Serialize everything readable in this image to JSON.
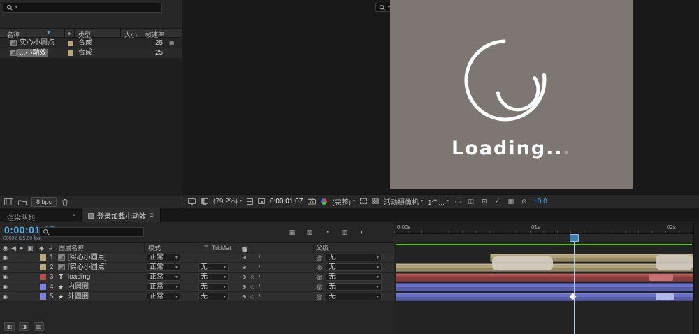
{
  "colors": {
    "accent_blue": "#3fa0ff",
    "time_display_blue": "#53a9e8",
    "comp_background": "#7d7672",
    "label_tan": "#b9a87e",
    "label_red": "#b94b4b",
    "label_blue": "#7d82dd",
    "bar_tan": "#b3a47c",
    "bar_red": "#a34a4a",
    "bar_blue": "#6b70c6",
    "work_area_green": "#5abf22"
  },
  "icons": {
    "caret_down": "▾",
    "sort_down": "▼",
    "close": "×",
    "menu": "≡",
    "tag": "◆",
    "hash": "#",
    "eye": "◉",
    "audio": "◀",
    "solo": "●",
    "lock": "▣",
    "collapse": "⊕",
    "fx_diamond": "◇",
    "quality": "/",
    "pickwhip": "@",
    "star": "★",
    "text_layer": "T",
    "flowchart": "▦",
    "sw_header": [
      "⊕",
      "◇",
      "\\",
      "fx",
      "▣",
      "⊘",
      "◎",
      "⊙"
    ],
    "tl_buttons": [
      "▦",
      "▧",
      "◔",
      "▥",
      "◐"
    ],
    "vt_buttons": [
      "▭",
      "◫",
      "⊞",
      "∠",
      "▦",
      "⊛"
    ],
    "bottom_buttons": [
      "◧",
      "◨",
      "▥"
    ]
  },
  "project": {
    "search_text": "",
    "columns": {
      "name": "名称",
      "type": "类型",
      "size": "大小",
      "framerate": "帧速率"
    },
    "rows": [
      {
        "name": "实心小圆点",
        "type": "合成",
        "framerate": "25"
      },
      {
        "name": "...小动效",
        "type": "合成",
        "framerate": "25"
      }
    ],
    "footer": {
      "bpc": "8 bpc"
    }
  },
  "viewer": {
    "loading_text": "Loading..",
    "loading_last_dot": ".",
    "toolbar": {
      "zoom": "(79.2%)",
      "time": "0:00:01:07",
      "resolution": "(完整)",
      "camera": "活动摄像机",
      "views": "1个...",
      "exposure": "+0.0"
    }
  },
  "tabs": {
    "render_queue": "渲染队列",
    "comp_tab": "登录加载小动效"
  },
  "timeline": {
    "current_time": "0:00:01:07",
    "frame_info": "00032 (25.00 fps)",
    "header": {
      "layer_name": "图层名称",
      "mode": "模式",
      "t_label": "T",
      "trkmat": "TrkMat",
      "parent": "父级"
    },
    "layers": [
      {
        "num": "1",
        "name": "[实心小圆点]",
        "mode": "正常",
        "trkmat": "",
        "parent": "无"
      },
      {
        "num": "2",
        "name": "[实心小圆点]",
        "mode": "正常",
        "trkmat": "无",
        "parent": "无"
      },
      {
        "num": "3",
        "name": "loading",
        "mode": "正常",
        "trkmat": "无",
        "parent": "无"
      },
      {
        "num": "4",
        "name": "内圆圈",
        "mode": "正常",
        "trkmat": "无",
        "parent": "无"
      },
      {
        "num": "5",
        "name": "外圆圈",
        "mode": "正常",
        "trkmat": "无",
        "parent": "无"
      }
    ],
    "ruler": {
      "t0": "0:00s",
      "t1": "01s",
      "t2": "02s"
    }
  }
}
